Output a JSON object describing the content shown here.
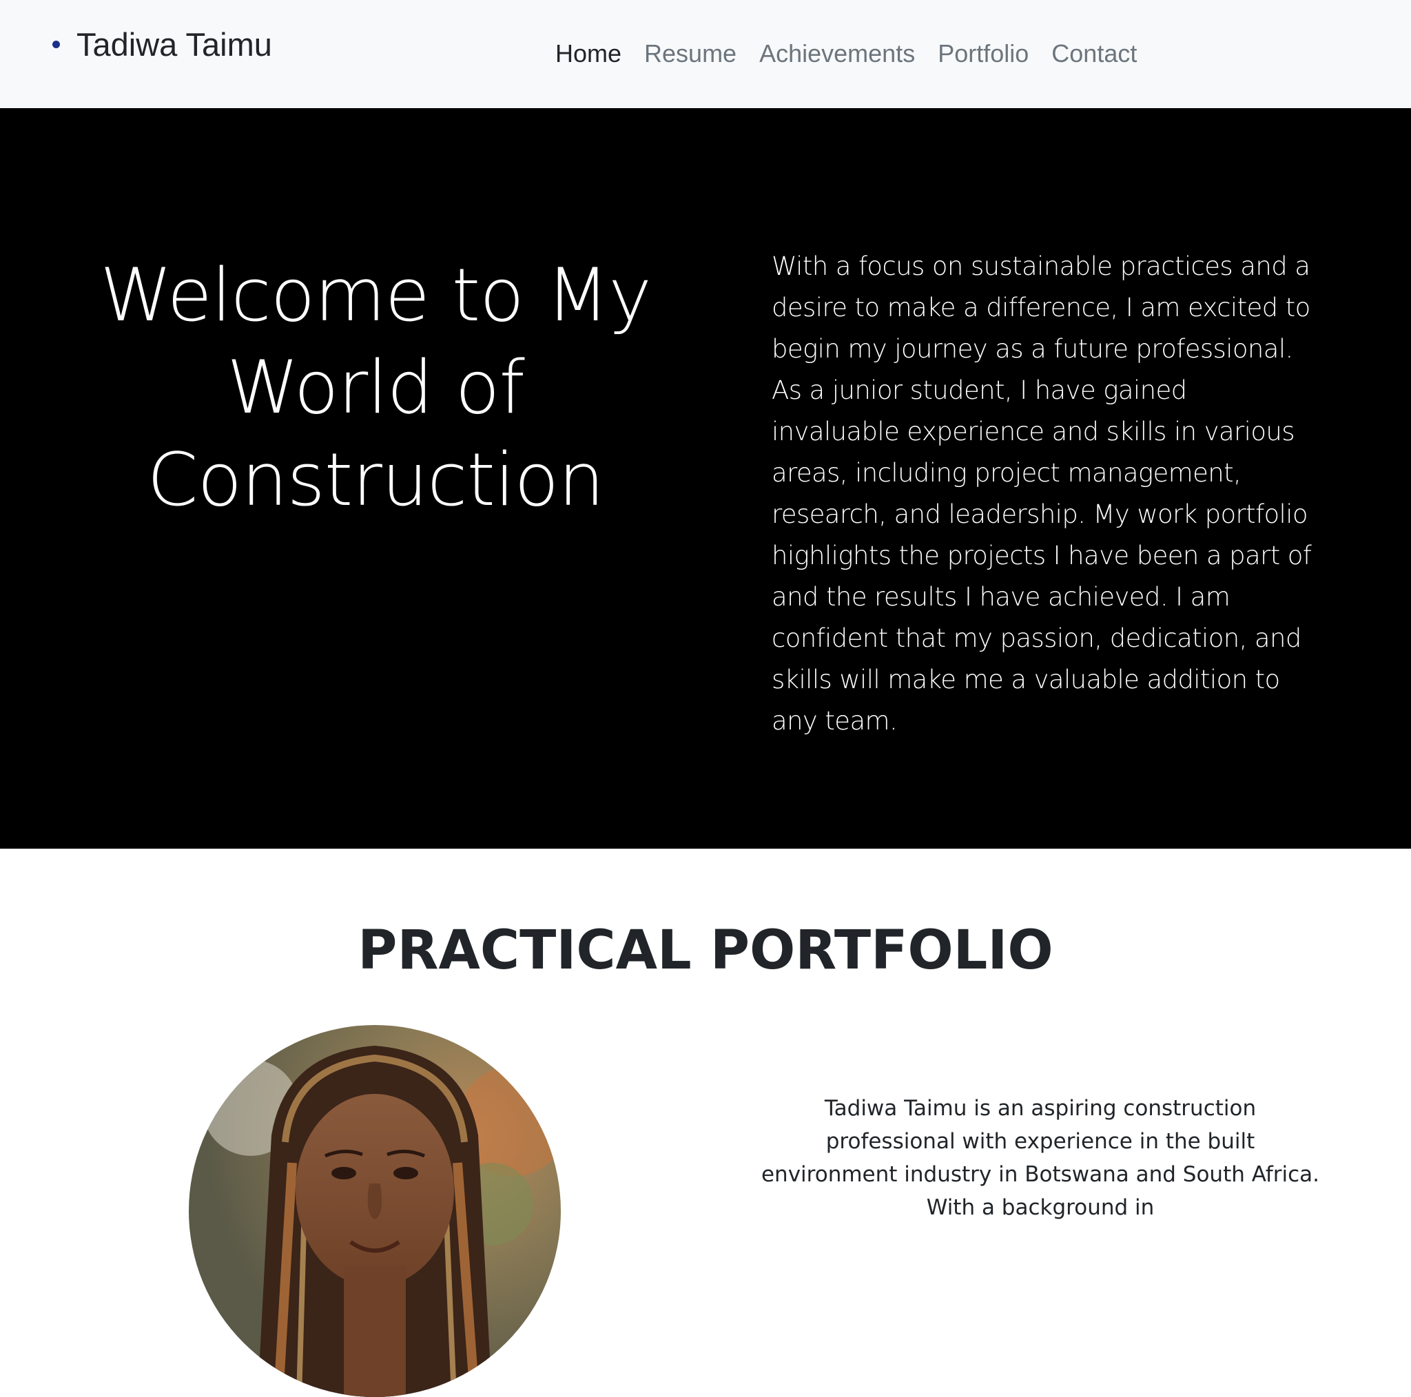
{
  "navbar": {
    "brand": "Tadiwa Taimu",
    "links": [
      {
        "label": "Home",
        "active": true
      },
      {
        "label": "Resume",
        "active": false
      },
      {
        "label": "Achievements",
        "active": false
      },
      {
        "label": "Portfolio",
        "active": false
      },
      {
        "label": "Contact",
        "active": false
      }
    ]
  },
  "hero": {
    "title": "Welcome to My World of Construction",
    "text": "With a focus on sustainable practices and a desire to make a difference, I am excited to begin my journey as a future professional. As a junior student, I have gained invaluable experience and skills in various areas, including project management, research, and leadership. My work portfolio highlights the projects I have been a part of and the results I have achieved. I am confident that my passion, dedication, and skills will make me a valuable addition to any team."
  },
  "portfolio": {
    "title": "PRACTICAL PORTFOLIO",
    "bio": "Tadiwa Taimu is an aspiring construction professional with experience in the built environment industry in Botswana and South Africa. With a background in"
  },
  "colors": {
    "navbar_bg": "#f8f9fa",
    "hero_bg": "#000000",
    "brand_bullet": "#1c2f8a",
    "nav_active": "#212529",
    "nav_inactive": "#6c757d"
  }
}
